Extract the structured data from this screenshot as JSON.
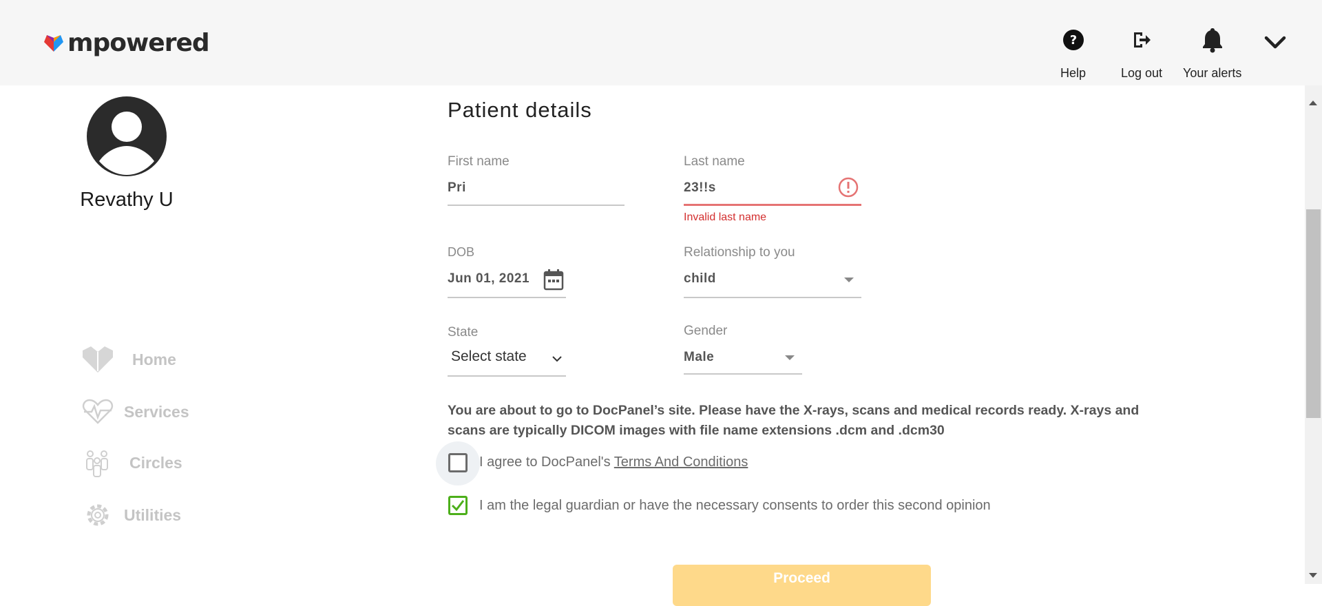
{
  "header": {
    "logo_text": "mpowered",
    "actions": [
      {
        "label": "Help",
        "icon": "help-circle-icon"
      },
      {
        "label": "Log out",
        "icon": "logout-icon"
      },
      {
        "label": "Your alerts",
        "icon": "bell-icon"
      }
    ],
    "menu_icon": "chevron-down-icon"
  },
  "sidebar": {
    "user_name": "Revathy U",
    "items": [
      {
        "label": "Home",
        "icon": "home-heart-icon"
      },
      {
        "label": "Services",
        "icon": "heart-pulse-icon"
      },
      {
        "label": "Circles",
        "icon": "people-icon"
      },
      {
        "label": "Utilities",
        "icon": "gear-icon"
      }
    ]
  },
  "form": {
    "title": "Patient details",
    "first_name": {
      "label": "First name",
      "value": "Pri"
    },
    "last_name": {
      "label": "Last name",
      "value": "23!!s",
      "error": "Invalid last name"
    },
    "dob": {
      "label": "DOB",
      "value": "Jun 01, 2021"
    },
    "relationship": {
      "label": "Relationship to you",
      "value": "child"
    },
    "state": {
      "label": "State",
      "value": "Select state"
    },
    "gender": {
      "label": "Gender",
      "value": "Male"
    },
    "info_text": "You are about to go to DocPanel’s site. Please have the X-rays, scans and medical records ready. X-rays and scans are typically DICOM images with file name extensions .dcm and .dcm30",
    "terms_checkbox": {
      "prefix": "I agree to DocPanel's ",
      "link": "Terms And Conditions",
      "checked": false
    },
    "guardian_checkbox": {
      "label": "I am the legal guardian or have the necessary consents to order this second opinion",
      "checked": true
    },
    "proceed_label": "Proceed"
  },
  "colors": {
    "error": "#d32f2f",
    "check": "#4caf1a",
    "proceed": "#fed98a"
  }
}
